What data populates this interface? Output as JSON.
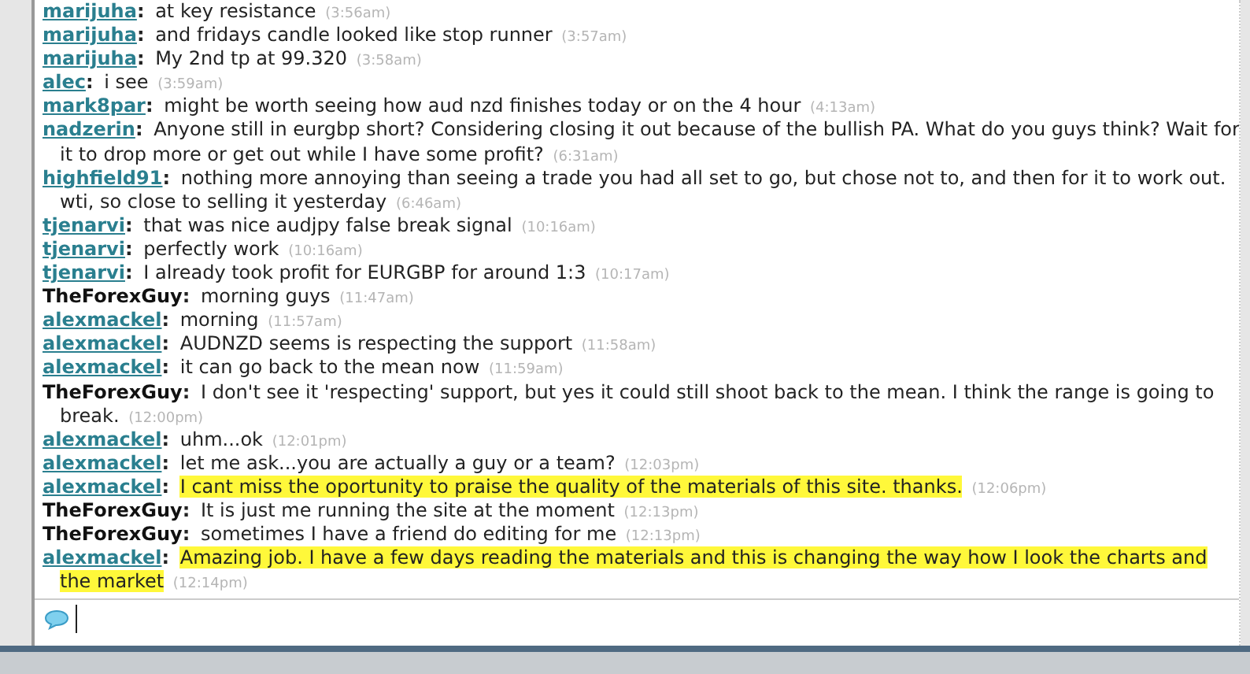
{
  "messages": [
    {
      "user": "marijuha",
      "sep": ":",
      "kind": "member",
      "lines": [
        "at key resistance"
      ],
      "time": "(3:56am)",
      "highlighted": false
    },
    {
      "user": "marijuha",
      "sep": ":",
      "kind": "member",
      "lines": [
        "and fridays candle looked like stop runner"
      ],
      "time": "(3:57am)",
      "highlighted": false
    },
    {
      "user": "marijuha",
      "sep": ":",
      "kind": "member",
      "lines": [
        "My 2nd tp at 99.320"
      ],
      "time": "(3:58am)",
      "highlighted": false
    },
    {
      "user": "alec",
      "sep": ":",
      "kind": "member",
      "lines": [
        "i see"
      ],
      "time": "(3:59am)",
      "highlighted": false
    },
    {
      "user": "mark8par",
      "sep": ":",
      "kind": "member",
      "lines": [
        "might be worth seeing how aud nzd finishes today or on the 4 hour"
      ],
      "time": "(4:13am)",
      "highlighted": false
    },
    {
      "user": "nadzerin",
      "sep": ":",
      "kind": "member",
      "lines": [
        "Anyone still in eurgbp short? Considering closing it out because of the bullish PA. What do you guys think? Wait for",
        "it to drop more or get out while I have some profit?"
      ],
      "time": "(6:31am)",
      "highlighted": false
    },
    {
      "user": "highfield91",
      "sep": ":",
      "kind": "member",
      "lines": [
        "nothing more annoying than seeing a trade you had all set to go, but chose not to, and then for it to work out.",
        "wti, so close to selling it yesterday"
      ],
      "time": "(6:46am)",
      "highlighted": false
    },
    {
      "user": "tjenarvi",
      "sep": ":",
      "kind": "member",
      "lines": [
        "that was nice audjpy false break signal"
      ],
      "time": "(10:16am)",
      "highlighted": false
    },
    {
      "user": "tjenarvi",
      "sep": ":",
      "kind": "member",
      "lines": [
        "perfectly work"
      ],
      "time": "(10:16am)",
      "highlighted": false
    },
    {
      "user": "tjenarvi",
      "sep": ":",
      "kind": "member",
      "lines": [
        "I already took profit for EURGBP for around 1:3"
      ],
      "time": "(10:17am)",
      "highlighted": false
    },
    {
      "user": "TheForexGuy",
      "sep": ":",
      "kind": "admin",
      "lines": [
        "morning guys"
      ],
      "time": "(11:47am)",
      "highlighted": false
    },
    {
      "user": "alexmackel",
      "sep": ":",
      "kind": "member",
      "lines": [
        "morning"
      ],
      "time": "(11:57am)",
      "highlighted": false
    },
    {
      "user": "alexmackel",
      "sep": ":",
      "kind": "member",
      "lines": [
        "AUDNZD seems is respecting the support"
      ],
      "time": "(11:58am)",
      "highlighted": false
    },
    {
      "user": "alexmackel",
      "sep": ":",
      "kind": "member",
      "lines": [
        "it can go back to the mean now"
      ],
      "time": "(11:59am)",
      "highlighted": false
    },
    {
      "user": "TheForexGuy",
      "sep": ":",
      "kind": "admin",
      "lines": [
        "I don't see it 'respecting' support, but yes it could still shoot back to the mean. I think the range is going to",
        "break."
      ],
      "time": "(12:00pm)",
      "highlighted": false
    },
    {
      "user": "alexmackel",
      "sep": ":",
      "kind": "member",
      "lines": [
        "uhm...ok"
      ],
      "time": "(12:01pm)",
      "highlighted": false
    },
    {
      "user": "alexmackel",
      "sep": ":",
      "kind": "member",
      "lines": [
        "let me ask...you are actually a guy or a team?"
      ],
      "time": "(12:03pm)",
      "highlighted": false
    },
    {
      "user": "alexmackel",
      "sep": ":",
      "kind": "member",
      "lines": [
        "I cant miss the oportunity to praise the quality of the materials of this site. thanks."
      ],
      "time": "(12:06pm)",
      "highlighted": true
    },
    {
      "user": "TheForexGuy",
      "sep": ":",
      "kind": "admin",
      "lines": [
        "It is just me running the site at the moment"
      ],
      "time": "(12:13pm)",
      "highlighted": false
    },
    {
      "user": "TheForexGuy",
      "sep": ":",
      "kind": "admin",
      "lines": [
        "sometimes I have a friend do editing for me"
      ],
      "time": "(12:13pm)",
      "highlighted": false
    },
    {
      "user": "alexmackel",
      "sep": ":",
      "kind": "member",
      "lines": [
        "Amazing job. I have a few days reading the materials and this is changing the way how I look the charts and",
        "the market"
      ],
      "time": "(12:14pm)",
      "highlighted": true
    }
  ]
}
